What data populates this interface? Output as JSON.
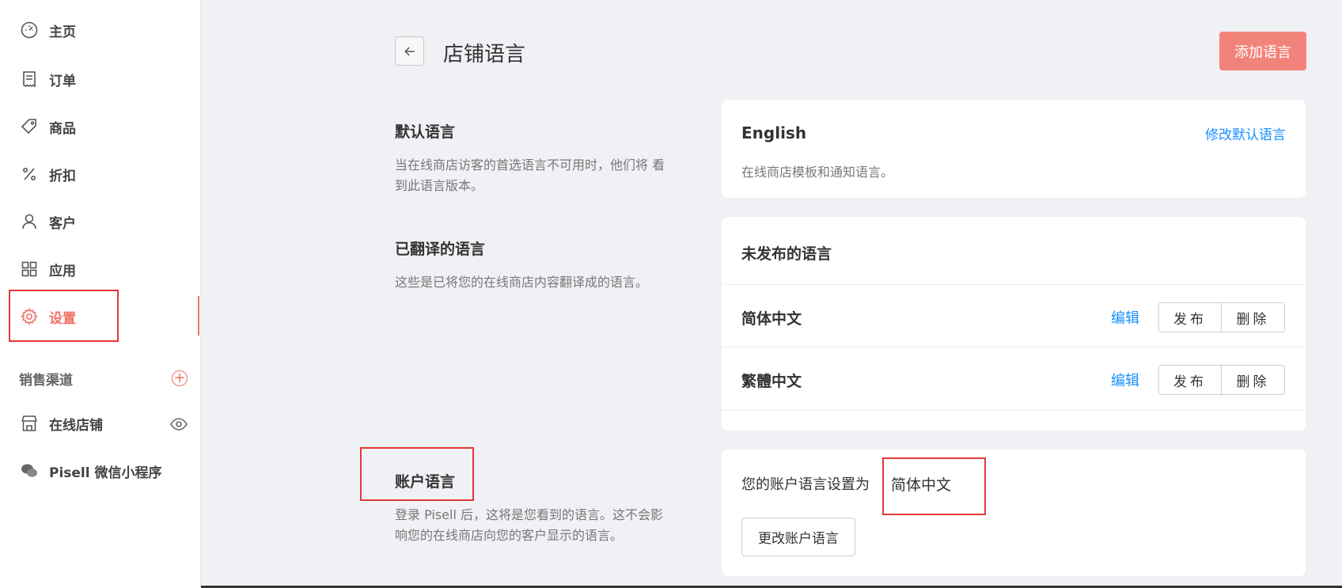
{
  "sidebar": {
    "items": [
      {
        "key": "home",
        "label": "主页",
        "icon": "dashboard-icon"
      },
      {
        "key": "orders",
        "label": "订单",
        "icon": "receipt-icon"
      },
      {
        "key": "products",
        "label": "商品",
        "icon": "tag-icon"
      },
      {
        "key": "discounts",
        "label": "折扣",
        "icon": "percent-icon"
      },
      {
        "key": "customers",
        "label": "客户",
        "icon": "user-icon"
      },
      {
        "key": "apps",
        "label": "应用",
        "icon": "grid-icon"
      },
      {
        "key": "settings",
        "label": "设置",
        "icon": "gear-icon",
        "active": true
      }
    ],
    "channels_title": "销售渠道",
    "online_store": "在线店铺",
    "mini_program": "Pisell 微信小程序"
  },
  "header": {
    "title": "店铺语言",
    "add_language": "添加语言"
  },
  "sections": {
    "default": {
      "title": "默认语言",
      "desc": "当在线商店访客的首选语言不可用时，他们将 看到此语言版本。",
      "language": "English",
      "change_label": "修改默认语言",
      "card_desc": "在线商店模板和通知语言。"
    },
    "translated": {
      "title": "已翻译的语言",
      "desc": "这些是已将您的在线商店内容翻译成的语言。",
      "unpublished_title": "未发布的语言",
      "edit_label": "编辑",
      "publish_label": "发布",
      "delete_label": "删除",
      "languages": [
        "简体中文",
        "繁體中文"
      ]
    },
    "account": {
      "title": "账户语言",
      "desc": "登录 Pisell 后，这将是您看到的语言。这不会影响您的在线商店向您的客户显示的语言。",
      "setting_text": "您的账户语言设置为",
      "value": "简体中文",
      "change_label": "更改账户语言"
    }
  },
  "colors": {
    "accent": "#ee7469",
    "link": "#1890ff",
    "highlight": "#e53935"
  }
}
